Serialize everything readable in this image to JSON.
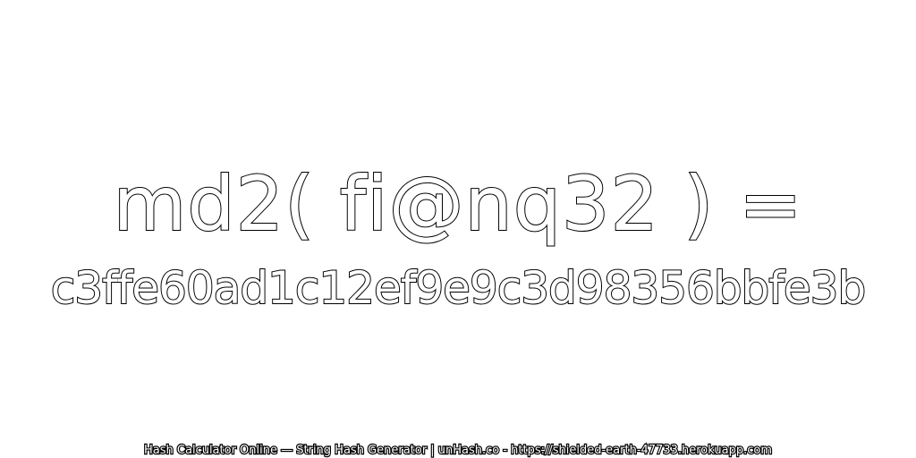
{
  "expression": "md2( fi@nq32 ) =",
  "hash_value": "c3ffe60ad1c12ef9e9c3d98356bbfe3b",
  "footer": "Hash Calculator Online — String Hash Generator | unHash.co - https://shielded-earth-47733.herokuapp.com",
  "colors": {
    "background": "#ffffff",
    "text_fill": "#ffffff",
    "text_outline": "#000000"
  }
}
